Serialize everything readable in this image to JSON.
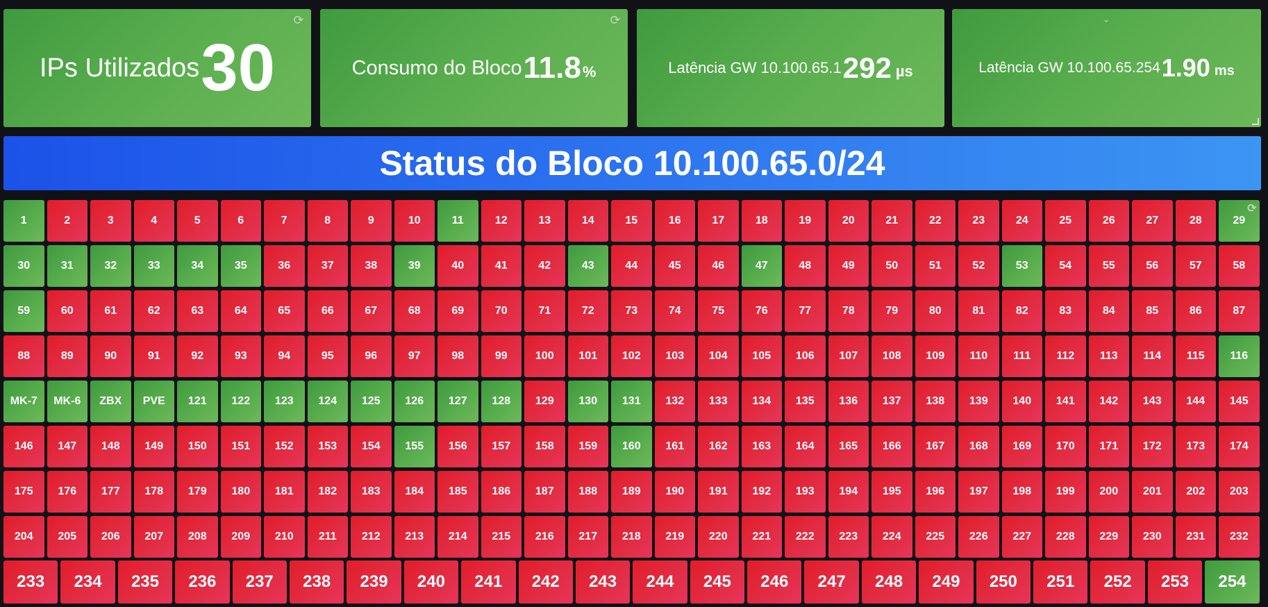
{
  "stats": [
    {
      "label": "IPs Utilizados",
      "value": "30",
      "unit": "",
      "icon": "refresh-icon"
    },
    {
      "label": "Consumo do Bloco",
      "value": "11.8",
      "unit": "%",
      "icon": "refresh-icon"
    },
    {
      "label": "Latência GW 10.100.65.1",
      "value": "292",
      "unit": "µs",
      "icon": ""
    },
    {
      "label": "Latência GW 10.100.65.254",
      "value": "1.90",
      "unit": "ms",
      "icon": "chevron-down-icon"
    }
  ],
  "banner": {
    "title": "Status do Bloco 10.100.65.0/24"
  },
  "colors": {
    "up": "#56a64b",
    "down": "#e02f44",
    "banner": "#2a6ff0"
  },
  "cells": [
    {
      "label": "1",
      "status": "up"
    },
    {
      "label": "2",
      "status": "down"
    },
    {
      "label": "3",
      "status": "down"
    },
    {
      "label": "4",
      "status": "down"
    },
    {
      "label": "5",
      "status": "down"
    },
    {
      "label": "6",
      "status": "down"
    },
    {
      "label": "7",
      "status": "down"
    },
    {
      "label": "8",
      "status": "down"
    },
    {
      "label": "9",
      "status": "down"
    },
    {
      "label": "10",
      "status": "down"
    },
    {
      "label": "11",
      "status": "up"
    },
    {
      "label": "12",
      "status": "down"
    },
    {
      "label": "13",
      "status": "down"
    },
    {
      "label": "14",
      "status": "down"
    },
    {
      "label": "15",
      "status": "down"
    },
    {
      "label": "16",
      "status": "down"
    },
    {
      "label": "17",
      "status": "down"
    },
    {
      "label": "18",
      "status": "down"
    },
    {
      "label": "19",
      "status": "down"
    },
    {
      "label": "20",
      "status": "down"
    },
    {
      "label": "21",
      "status": "down"
    },
    {
      "label": "22",
      "status": "down"
    },
    {
      "label": "23",
      "status": "down"
    },
    {
      "label": "24",
      "status": "down"
    },
    {
      "label": "25",
      "status": "down"
    },
    {
      "label": "26",
      "status": "down"
    },
    {
      "label": "27",
      "status": "down"
    },
    {
      "label": "28",
      "status": "down"
    },
    {
      "label": "29",
      "status": "up"
    },
    {
      "label": "30",
      "status": "up"
    },
    {
      "label": "31",
      "status": "up"
    },
    {
      "label": "32",
      "status": "up"
    },
    {
      "label": "33",
      "status": "up"
    },
    {
      "label": "34",
      "status": "up"
    },
    {
      "label": "35",
      "status": "up"
    },
    {
      "label": "36",
      "status": "down"
    },
    {
      "label": "37",
      "status": "down"
    },
    {
      "label": "38",
      "status": "down"
    },
    {
      "label": "39",
      "status": "up"
    },
    {
      "label": "40",
      "status": "down"
    },
    {
      "label": "41",
      "status": "down"
    },
    {
      "label": "42",
      "status": "down"
    },
    {
      "label": "43",
      "status": "up"
    },
    {
      "label": "44",
      "status": "down"
    },
    {
      "label": "45",
      "status": "down"
    },
    {
      "label": "46",
      "status": "down"
    },
    {
      "label": "47",
      "status": "up"
    },
    {
      "label": "48",
      "status": "down"
    },
    {
      "label": "49",
      "status": "down"
    },
    {
      "label": "50",
      "status": "down"
    },
    {
      "label": "51",
      "status": "down"
    },
    {
      "label": "52",
      "status": "down"
    },
    {
      "label": "53",
      "status": "up"
    },
    {
      "label": "54",
      "status": "down"
    },
    {
      "label": "55",
      "status": "down"
    },
    {
      "label": "56",
      "status": "down"
    },
    {
      "label": "57",
      "status": "down"
    },
    {
      "label": "58",
      "status": "down"
    },
    {
      "label": "59",
      "status": "up"
    },
    {
      "label": "60",
      "status": "down"
    },
    {
      "label": "61",
      "status": "down"
    },
    {
      "label": "62",
      "status": "down"
    },
    {
      "label": "63",
      "status": "down"
    },
    {
      "label": "64",
      "status": "down"
    },
    {
      "label": "65",
      "status": "down"
    },
    {
      "label": "66",
      "status": "down"
    },
    {
      "label": "67",
      "status": "down"
    },
    {
      "label": "68",
      "status": "down"
    },
    {
      "label": "69",
      "status": "down"
    },
    {
      "label": "70",
      "status": "down"
    },
    {
      "label": "71",
      "status": "down"
    },
    {
      "label": "72",
      "status": "down"
    },
    {
      "label": "73",
      "status": "down"
    },
    {
      "label": "74",
      "status": "down"
    },
    {
      "label": "75",
      "status": "down"
    },
    {
      "label": "76",
      "status": "down"
    },
    {
      "label": "77",
      "status": "down"
    },
    {
      "label": "78",
      "status": "down"
    },
    {
      "label": "79",
      "status": "down"
    },
    {
      "label": "80",
      "status": "down"
    },
    {
      "label": "81",
      "status": "down"
    },
    {
      "label": "82",
      "status": "down"
    },
    {
      "label": "83",
      "status": "down"
    },
    {
      "label": "84",
      "status": "down"
    },
    {
      "label": "85",
      "status": "down"
    },
    {
      "label": "86",
      "status": "down"
    },
    {
      "label": "87",
      "status": "down"
    },
    {
      "label": "88",
      "status": "down"
    },
    {
      "label": "89",
      "status": "down"
    },
    {
      "label": "90",
      "status": "down"
    },
    {
      "label": "91",
      "status": "down"
    },
    {
      "label": "92",
      "status": "down"
    },
    {
      "label": "93",
      "status": "down"
    },
    {
      "label": "94",
      "status": "down"
    },
    {
      "label": "95",
      "status": "down"
    },
    {
      "label": "96",
      "status": "down"
    },
    {
      "label": "97",
      "status": "down"
    },
    {
      "label": "98",
      "status": "down"
    },
    {
      "label": "99",
      "status": "down"
    },
    {
      "label": "100",
      "status": "down"
    },
    {
      "label": "101",
      "status": "down"
    },
    {
      "label": "102",
      "status": "down"
    },
    {
      "label": "103",
      "status": "down"
    },
    {
      "label": "104",
      "status": "down"
    },
    {
      "label": "105",
      "status": "down"
    },
    {
      "label": "106",
      "status": "down"
    },
    {
      "label": "107",
      "status": "down"
    },
    {
      "label": "108",
      "status": "down"
    },
    {
      "label": "109",
      "status": "down"
    },
    {
      "label": "110",
      "status": "down"
    },
    {
      "label": "111",
      "status": "down"
    },
    {
      "label": "112",
      "status": "down"
    },
    {
      "label": "113",
      "status": "down"
    },
    {
      "label": "114",
      "status": "down"
    },
    {
      "label": "115",
      "status": "down"
    },
    {
      "label": "116",
      "status": "up"
    },
    {
      "label": "MK-7",
      "status": "up"
    },
    {
      "label": "MK-6",
      "status": "up"
    },
    {
      "label": "ZBX",
      "status": "up"
    },
    {
      "label": "PVE",
      "status": "up"
    },
    {
      "label": "121",
      "status": "up"
    },
    {
      "label": "122",
      "status": "up"
    },
    {
      "label": "123",
      "status": "up"
    },
    {
      "label": "124",
      "status": "up"
    },
    {
      "label": "125",
      "status": "up"
    },
    {
      "label": "126",
      "status": "up"
    },
    {
      "label": "127",
      "status": "up"
    },
    {
      "label": "128",
      "status": "up"
    },
    {
      "label": "129",
      "status": "down"
    },
    {
      "label": "130",
      "status": "up"
    },
    {
      "label": "131",
      "status": "up"
    },
    {
      "label": "132",
      "status": "down"
    },
    {
      "label": "133",
      "status": "down"
    },
    {
      "label": "134",
      "status": "down"
    },
    {
      "label": "135",
      "status": "down"
    },
    {
      "label": "136",
      "status": "down"
    },
    {
      "label": "137",
      "status": "down"
    },
    {
      "label": "138",
      "status": "down"
    },
    {
      "label": "139",
      "status": "down"
    },
    {
      "label": "140",
      "status": "down"
    },
    {
      "label": "141",
      "status": "down"
    },
    {
      "label": "142",
      "status": "down"
    },
    {
      "label": "143",
      "status": "down"
    },
    {
      "label": "144",
      "status": "down"
    },
    {
      "label": "145",
      "status": "down"
    },
    {
      "label": "146",
      "status": "down"
    },
    {
      "label": "147",
      "status": "down"
    },
    {
      "label": "148",
      "status": "down"
    },
    {
      "label": "149",
      "status": "down"
    },
    {
      "label": "150",
      "status": "down"
    },
    {
      "label": "151",
      "status": "down"
    },
    {
      "label": "152",
      "status": "down"
    },
    {
      "label": "153",
      "status": "down"
    },
    {
      "label": "154",
      "status": "down"
    },
    {
      "label": "155",
      "status": "up"
    },
    {
      "label": "156",
      "status": "down"
    },
    {
      "label": "157",
      "status": "down"
    },
    {
      "label": "158",
      "status": "down"
    },
    {
      "label": "159",
      "status": "down"
    },
    {
      "label": "160",
      "status": "up"
    },
    {
      "label": "161",
      "status": "down"
    },
    {
      "label": "162",
      "status": "down"
    },
    {
      "label": "163",
      "status": "down"
    },
    {
      "label": "164",
      "status": "down"
    },
    {
      "label": "165",
      "status": "down"
    },
    {
      "label": "166",
      "status": "down"
    },
    {
      "label": "167",
      "status": "down"
    },
    {
      "label": "168",
      "status": "down"
    },
    {
      "label": "169",
      "status": "down"
    },
    {
      "label": "170",
      "status": "down"
    },
    {
      "label": "171",
      "status": "down"
    },
    {
      "label": "172",
      "status": "down"
    },
    {
      "label": "173",
      "status": "down"
    },
    {
      "label": "174",
      "status": "down"
    },
    {
      "label": "175",
      "status": "down"
    },
    {
      "label": "176",
      "status": "down"
    },
    {
      "label": "177",
      "status": "down"
    },
    {
      "label": "178",
      "status": "down"
    },
    {
      "label": "179",
      "status": "down"
    },
    {
      "label": "180",
      "status": "down"
    },
    {
      "label": "181",
      "status": "down"
    },
    {
      "label": "182",
      "status": "down"
    },
    {
      "label": "183",
      "status": "down"
    },
    {
      "label": "184",
      "status": "down"
    },
    {
      "label": "185",
      "status": "down"
    },
    {
      "label": "186",
      "status": "down"
    },
    {
      "label": "187",
      "status": "down"
    },
    {
      "label": "188",
      "status": "down"
    },
    {
      "label": "189",
      "status": "down"
    },
    {
      "label": "190",
      "status": "down"
    },
    {
      "label": "191",
      "status": "down"
    },
    {
      "label": "192",
      "status": "down"
    },
    {
      "label": "193",
      "status": "down"
    },
    {
      "label": "194",
      "status": "down"
    },
    {
      "label": "195",
      "status": "down"
    },
    {
      "label": "196",
      "status": "down"
    },
    {
      "label": "197",
      "status": "down"
    },
    {
      "label": "198",
      "status": "down"
    },
    {
      "label": "199",
      "status": "down"
    },
    {
      "label": "200",
      "status": "down"
    },
    {
      "label": "201",
      "status": "down"
    },
    {
      "label": "202",
      "status": "down"
    },
    {
      "label": "203",
      "status": "down"
    },
    {
      "label": "204",
      "status": "down"
    },
    {
      "label": "205",
      "status": "down"
    },
    {
      "label": "206",
      "status": "down"
    },
    {
      "label": "207",
      "status": "down"
    },
    {
      "label": "208",
      "status": "down"
    },
    {
      "label": "209",
      "status": "down"
    },
    {
      "label": "210",
      "status": "down"
    },
    {
      "label": "211",
      "status": "down"
    },
    {
      "label": "212",
      "status": "down"
    },
    {
      "label": "213",
      "status": "down"
    },
    {
      "label": "214",
      "status": "down"
    },
    {
      "label": "215",
      "status": "down"
    },
    {
      "label": "216",
      "status": "down"
    },
    {
      "label": "217",
      "status": "down"
    },
    {
      "label": "218",
      "status": "down"
    },
    {
      "label": "219",
      "status": "down"
    },
    {
      "label": "220",
      "status": "down"
    },
    {
      "label": "221",
      "status": "down"
    },
    {
      "label": "222",
      "status": "down"
    },
    {
      "label": "223",
      "status": "down"
    },
    {
      "label": "224",
      "status": "down"
    },
    {
      "label": "225",
      "status": "down"
    },
    {
      "label": "226",
      "status": "down"
    },
    {
      "label": "227",
      "status": "down"
    },
    {
      "label": "228",
      "status": "down"
    },
    {
      "label": "229",
      "status": "down"
    },
    {
      "label": "230",
      "status": "down"
    },
    {
      "label": "231",
      "status": "down"
    },
    {
      "label": "232",
      "status": "down"
    }
  ],
  "last_row": [
    {
      "label": "233",
      "status": "down"
    },
    {
      "label": "234",
      "status": "down"
    },
    {
      "label": "235",
      "status": "down"
    },
    {
      "label": "236",
      "status": "down"
    },
    {
      "label": "237",
      "status": "down"
    },
    {
      "label": "238",
      "status": "down"
    },
    {
      "label": "239",
      "status": "down"
    },
    {
      "label": "240",
      "status": "down"
    },
    {
      "label": "241",
      "status": "down"
    },
    {
      "label": "242",
      "status": "down"
    },
    {
      "label": "243",
      "status": "down"
    },
    {
      "label": "244",
      "status": "down"
    },
    {
      "label": "245",
      "status": "down"
    },
    {
      "label": "246",
      "status": "down"
    },
    {
      "label": "247",
      "status": "down"
    },
    {
      "label": "248",
      "status": "down"
    },
    {
      "label": "249",
      "status": "down"
    },
    {
      "label": "250",
      "status": "down"
    },
    {
      "label": "251",
      "status": "down"
    },
    {
      "label": "252",
      "status": "down"
    },
    {
      "label": "253",
      "status": "down"
    },
    {
      "label": "254",
      "status": "up"
    }
  ]
}
